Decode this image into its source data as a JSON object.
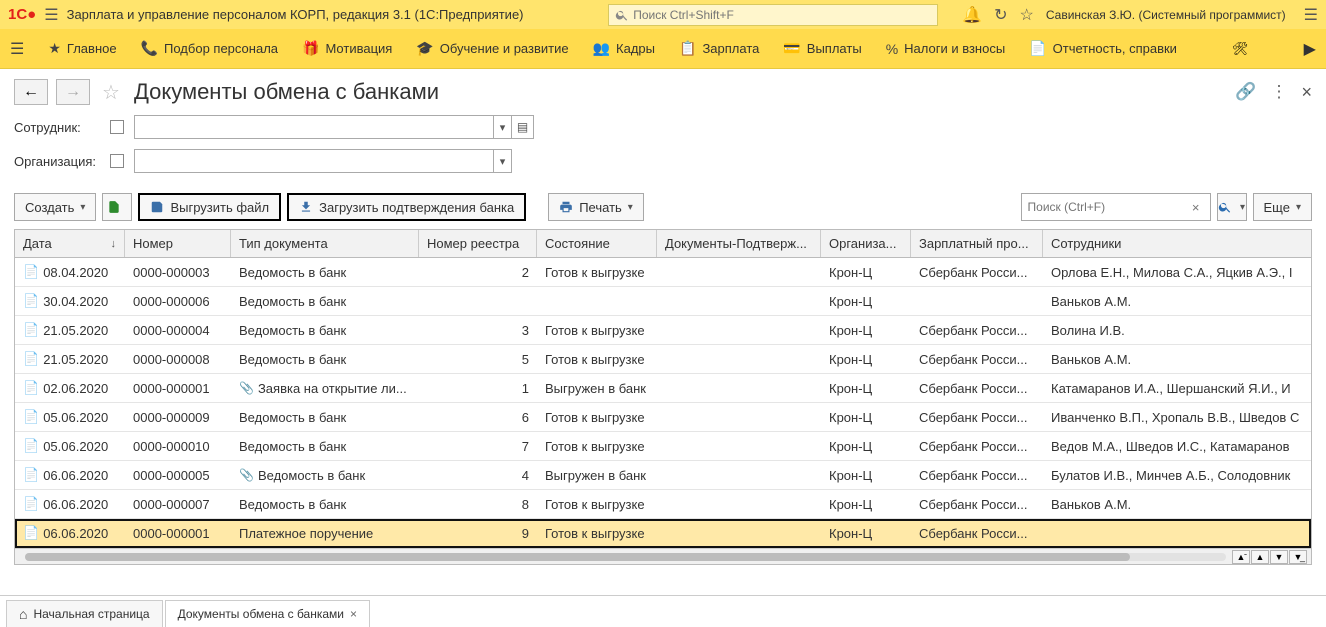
{
  "app": {
    "title": "Зарплата и управление персоналом КОРП, редакция 3.1  (1С:Предприятие)",
    "search_placeholder": "Поиск Ctrl+Shift+F",
    "user": "Савинская З.Ю. (Системный программист)"
  },
  "nav": {
    "items": [
      {
        "label": "Главное"
      },
      {
        "label": "Подбор персонала"
      },
      {
        "label": "Мотивация"
      },
      {
        "label": "Обучение и развитие"
      },
      {
        "label": "Кадры"
      },
      {
        "label": "Зарплата"
      },
      {
        "label": "Выплаты"
      },
      {
        "label": "Налоги и взносы"
      },
      {
        "label": "Отчетность, справки"
      }
    ]
  },
  "page": {
    "title": "Документы обмена с банками"
  },
  "filters": {
    "employee_label": "Сотрудник:",
    "org_label": "Организация:"
  },
  "toolbar": {
    "create": "Создать",
    "export_file": "Выгрузить файл",
    "import_confirm": "Загрузить подтверждения банка",
    "print": "Печать",
    "search_placeholder": "Поиск (Ctrl+F)",
    "more": "Еще"
  },
  "table": {
    "headers": {
      "date": "Дата",
      "number": "Номер",
      "doc_type": "Тип документа",
      "reestr": "Номер реестра",
      "state": "Состояние",
      "docs": "Документы-Подтверж...",
      "org": "Организа...",
      "project": "Зарплатный про...",
      "employees": "Сотрудники"
    },
    "rows": [
      {
        "date": "08.04.2020",
        "num": "0000-000003",
        "type": "Ведомость в банк",
        "reestr": "2",
        "state": "Готов к выгрузке",
        "docs": "",
        "org": "Крон-Ц",
        "proj": "Сбербанк Росси...",
        "sotr": "Орлова Е.Н., Милова С.А., Яцкив А.Э., I",
        "clip": false,
        "selected": false
      },
      {
        "date": "30.04.2020",
        "num": "0000-000006",
        "type": "Ведомость в банк",
        "reestr": "",
        "state": "",
        "docs": "",
        "org": "Крон-Ц",
        "proj": "",
        "sotr": "Ваньков А.М.",
        "clip": false,
        "selected": false
      },
      {
        "date": "21.05.2020",
        "num": "0000-000004",
        "type": "Ведомость в банк",
        "reestr": "3",
        "state": "Готов к выгрузке",
        "docs": "",
        "org": "Крон-Ц",
        "proj": "Сбербанк Росси...",
        "sotr": "Волина И.В.",
        "clip": false,
        "selected": false
      },
      {
        "date": "21.05.2020",
        "num": "0000-000008",
        "type": "Ведомость в банк",
        "reestr": "5",
        "state": "Готов к выгрузке",
        "docs": "",
        "org": "Крон-Ц",
        "proj": "Сбербанк Росси...",
        "sotr": "Ваньков А.М.",
        "clip": false,
        "selected": false
      },
      {
        "date": "02.06.2020",
        "num": "0000-000001",
        "type": "Заявка на открытие ли...",
        "reestr": "1",
        "state": "Выгружен в банк",
        "docs": "",
        "org": "Крон-Ц",
        "proj": "Сбербанк Росси...",
        "sotr": "Катамаранов И.А., Шершанский Я.И., И",
        "clip": true,
        "selected": false
      },
      {
        "date": "05.06.2020",
        "num": "0000-000009",
        "type": "Ведомость в банк",
        "reestr": "6",
        "state": "Готов к выгрузке",
        "docs": "",
        "org": "Крон-Ц",
        "proj": "Сбербанк Росси...",
        "sotr": "Иванченко В.П., Хропаль В.В., Шведов С",
        "clip": false,
        "selected": false
      },
      {
        "date": "05.06.2020",
        "num": "0000-000010",
        "type": "Ведомость в банк",
        "reestr": "7",
        "state": "Готов к выгрузке",
        "docs": "",
        "org": "Крон-Ц",
        "proj": "Сбербанк Росси...",
        "sotr": "Ведов М.А., Шведов И.С., Катамаранов",
        "clip": false,
        "selected": false
      },
      {
        "date": "06.06.2020",
        "num": "0000-000005",
        "type": "Ведомость в банк",
        "reestr": "4",
        "state": "Выгружен в банк",
        "docs": "",
        "org": "Крон-Ц",
        "proj": "Сбербанк Росси...",
        "sotr": "Булатов И.В., Минчев А.Б., Солодовник",
        "clip": true,
        "selected": false
      },
      {
        "date": "06.06.2020",
        "num": "0000-000007",
        "type": "Ведомость в банк",
        "reestr": "8",
        "state": "Готов к выгрузке",
        "docs": "",
        "org": "Крон-Ц",
        "proj": "Сбербанк Росси...",
        "sotr": "Ваньков А.М.",
        "clip": false,
        "selected": false
      },
      {
        "date": "06.06.2020",
        "num": "0000-000001",
        "type": "Платежное поручение",
        "reestr": "9",
        "state": "Готов к выгрузке",
        "docs": "",
        "org": "Крон-Ц",
        "proj": "Сбербанк Росси...",
        "sotr": "",
        "clip": false,
        "selected": true
      }
    ]
  },
  "tabs": {
    "home": "Начальная страница",
    "current": "Документы обмена с банками"
  }
}
